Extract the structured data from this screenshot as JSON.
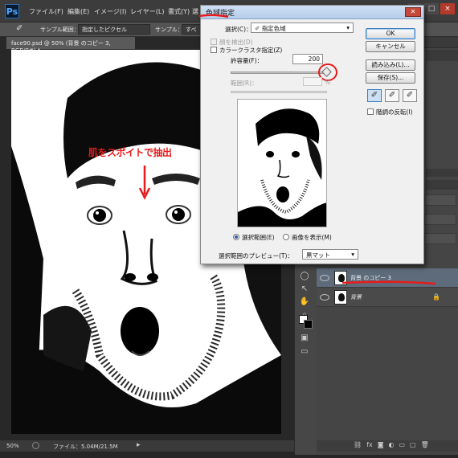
{
  "app": {
    "logo": "Ps"
  },
  "menu": {
    "items": [
      "ファイル(F)",
      "編集(E)",
      "イメージ(I)",
      "レイヤー(L)",
      "書式(Y)",
      "選"
    ]
  },
  "options": {
    "sample_label": "サンプル範囲：",
    "sample_value": "指定したピクセル",
    "sample2_label": "サンプル：",
    "sample2_value": "すべて"
  },
  "document": {
    "tab_title": "face90.psd @ 50% (背景 のコピー 3, RGB/8#) *",
    "zoom": "50%",
    "file_info": "ファイル：5.04M/21.5M"
  },
  "annotation": {
    "text": "肌をスポイトで抽出",
    "color": "#e61b1b"
  },
  "dialog": {
    "title": "色域指定",
    "select_label": "選択(C)：",
    "select_value": "指定色域",
    "detect_faces": "顔を検出(D)",
    "localized_clusters": "カラークラスタ指定(Z)",
    "fuzziness_label": "許容量(F)：",
    "fuzziness_value": "200",
    "fuzziness_level": 1.0,
    "range_label": "範囲(R)：",
    "range_unit": "%",
    "radio_selection": "選択範囲(E)",
    "radio_image": "画像を表示(M)",
    "preview_label": "選択範囲のプレビュー(T)：",
    "preview_value": "黒マット",
    "ok": "OK",
    "cancel": "キャンセル",
    "load": "読み込み(L)...",
    "save": "保存(S)...",
    "invert": "階調の反転(I)"
  },
  "layers": [
    {
      "name": "背景 のコピー 3",
      "selected": true
    },
    {
      "name": "背景",
      "selected": false
    }
  ],
  "icons": {
    "eyedropper": "eyedropper-icon",
    "lock": "lock-icon",
    "eye": "eye-icon"
  },
  "colors": {
    "accent_red": "#e61b1b",
    "panel": "#454545",
    "dialog_bg": "#f0f0f0"
  }
}
